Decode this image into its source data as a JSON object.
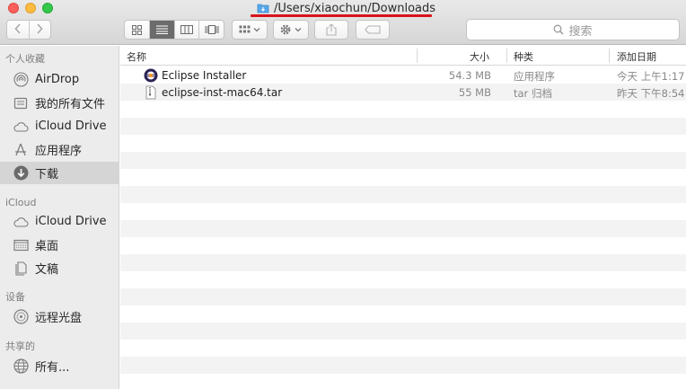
{
  "window": {
    "title": "/Users/xiaochun/Downloads"
  },
  "toolbar": {
    "back_icon": "chevron-left",
    "forward_icon": "chevron-right",
    "views": [
      "icon-view",
      "list-view",
      "column-view",
      "cover-flow-view"
    ],
    "active_view": "list-view",
    "search_placeholder": "搜索"
  },
  "sidebar": {
    "favorites_header": "个人收藏",
    "favorites": [
      {
        "label": "AirDrop",
        "icon": "airdrop-icon"
      },
      {
        "label": "我的所有文件",
        "icon": "all-files-icon"
      },
      {
        "label": "iCloud Drive",
        "icon": "cloud-icon"
      },
      {
        "label": "应用程序",
        "icon": "applications-icon"
      },
      {
        "label": "下载",
        "icon": "downloads-icon"
      }
    ],
    "icloud_header": "iCloud",
    "icloud": [
      {
        "label": "iCloud Drive",
        "icon": "cloud-icon"
      },
      {
        "label": "桌面",
        "icon": "desktop-icon"
      },
      {
        "label": "文稿",
        "icon": "documents-icon"
      }
    ],
    "devices_header": "设备",
    "devices": [
      {
        "label": "远程光盘",
        "icon": "remote-disc-icon"
      }
    ],
    "shared_header": "共享的",
    "shared": [
      {
        "label": "所有...",
        "icon": "network-icon"
      }
    ]
  },
  "columns": {
    "name": "名称",
    "size": "大小",
    "kind": "种类",
    "date": "添加日期"
  },
  "files": [
    {
      "name": "Eclipse Installer",
      "size": "54.3 MB",
      "kind": "应用程序",
      "date": "今天 上午1:17"
    },
    {
      "name": "eclipse-inst-mac64.tar",
      "size": "55 MB",
      "kind": "tar 归档",
      "date": "昨天 下午8:54"
    }
  ],
  "colors": {
    "title_underline": "#d9131c",
    "selected_sidebar": "#d5d5d5"
  }
}
